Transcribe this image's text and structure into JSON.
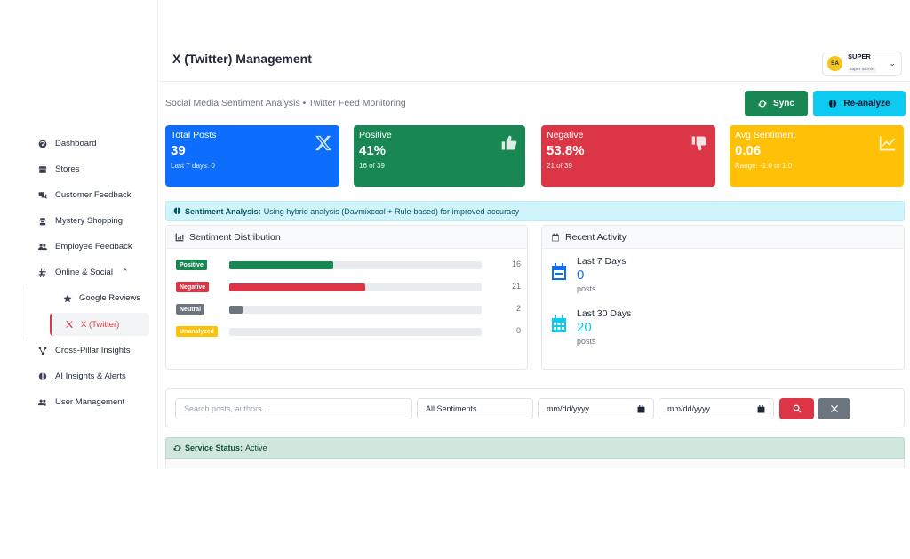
{
  "sidebar": {
    "items": [
      {
        "label": "Dashboard",
        "icon": "gauge-icon"
      },
      {
        "label": "Stores",
        "icon": "store-icon"
      },
      {
        "label": "Customer Feedback",
        "icon": "comments-icon"
      },
      {
        "label": "Mystery Shopping",
        "icon": "user-secret-icon"
      },
      {
        "label": "Employee Feedback",
        "icon": "users-icon"
      },
      {
        "label": "Online & Social",
        "icon": "hashtag-icon"
      },
      {
        "label": "Cross-Pillar Insights",
        "icon": "diagram-icon"
      },
      {
        "label": "AI Insights & Alerts",
        "icon": "brain-icon"
      },
      {
        "label": "User Management",
        "icon": "users-cog-icon"
      }
    ],
    "sub_items": [
      {
        "label": "Google Reviews",
        "icon": "star-icon"
      },
      {
        "label": "X (Twitter)",
        "icon": "x-logo-icon"
      }
    ]
  },
  "header": {
    "title": "X (Twitter) Management",
    "user": {
      "initials": "SA",
      "name": "SUPER",
      "role": "super admin"
    }
  },
  "main": {
    "subtitle": "Social Media Sentiment Analysis • Twitter Feed Monitoring",
    "buttons": {
      "sync": "Sync",
      "reanalyze": "Re-analyze"
    },
    "cards": [
      {
        "label": "Total Posts",
        "value": "39",
        "note": "Last 7 days: 0",
        "color": "#0d6efd"
      },
      {
        "label": "Positive",
        "value": "41%",
        "note": "16 of 39",
        "color": "#198754"
      },
      {
        "label": "Negative",
        "value": "53.8%",
        "note": "21 of 39",
        "color": "#dc3545"
      },
      {
        "label": "Avg Sentiment",
        "value": "0.06",
        "note": "Range: -1.0 to 1.0",
        "color": "#ffc107"
      }
    ],
    "info": {
      "title": "Sentiment Analysis:",
      "text": "Using hybrid analysis (Davmixcool + Rule-based) for improved accuracy"
    },
    "distribution": {
      "title": "Sentiment Distribution",
      "total": 39,
      "rows": [
        {
          "label": "Positive",
          "count": 16,
          "color": "#198754"
        },
        {
          "label": "Negative",
          "count": 21,
          "color": "#dc3545"
        },
        {
          "label": "Neutral",
          "count": 2,
          "color": "#6c757d"
        },
        {
          "label": "Unanalyzed",
          "count": 0,
          "color": "#ffc107"
        }
      ]
    },
    "activity": {
      "title": "Recent Activity",
      "items": [
        {
          "label": "Last 7 Days",
          "value": "0",
          "unit": "posts",
          "color": "#0d6efd"
        },
        {
          "label": "Last 30 Days",
          "value": "20",
          "unit": "posts",
          "color": "#0dcaf0"
        }
      ]
    },
    "filters": {
      "search_placeholder": "Search posts, authors...",
      "sentiment_value": "All Sentiments",
      "date_from": "mm/dd/yyyy",
      "date_to": "mm/dd/yyyy"
    },
    "status": {
      "title": "Service Status:",
      "text": "Active"
    }
  }
}
